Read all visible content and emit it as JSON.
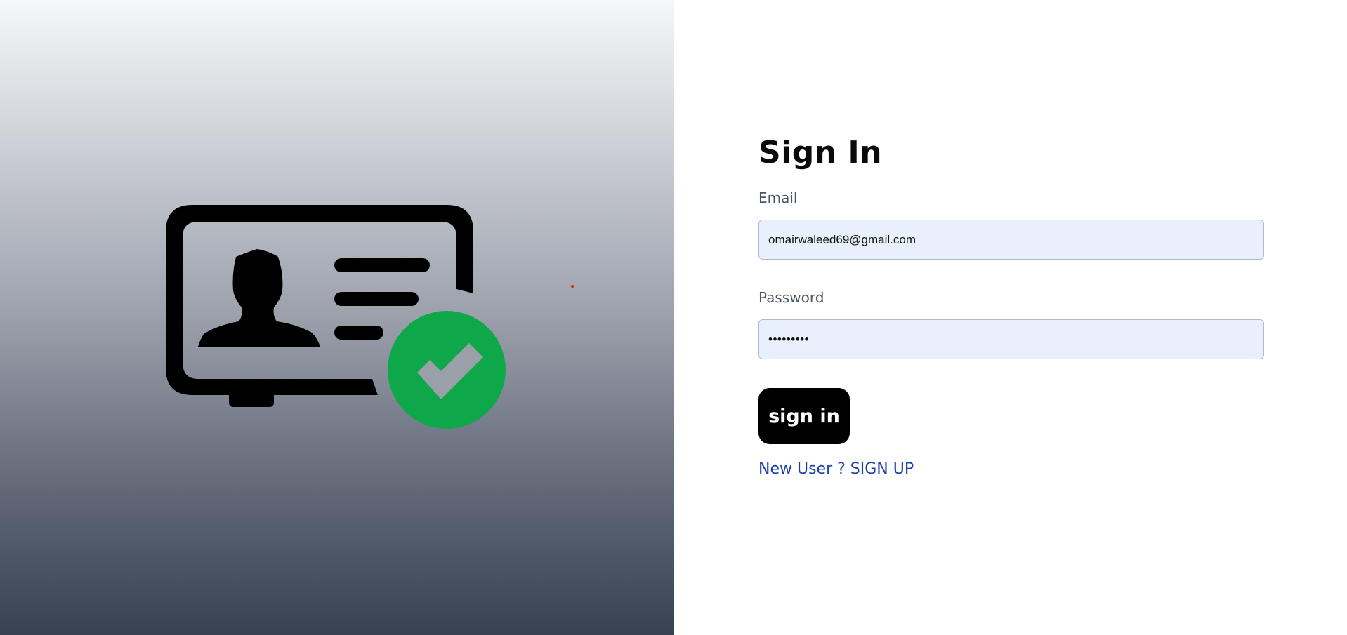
{
  "login": {
    "title": "Sign In",
    "email": {
      "label": "Email",
      "value": "omairwaleed69@gmail.com"
    },
    "password": {
      "label": "Password",
      "value": "•••••••••"
    },
    "submit_label": "sign in",
    "signup_link": "New User ? SIGN UP"
  },
  "illustration": {
    "icon": "id-card-verified-icon",
    "check_color": "#0ea74a",
    "card_color": "#000000"
  },
  "colors": {
    "link": "#1e40af",
    "input_bg": "#e8f0fe",
    "button_bg": "#000000"
  }
}
